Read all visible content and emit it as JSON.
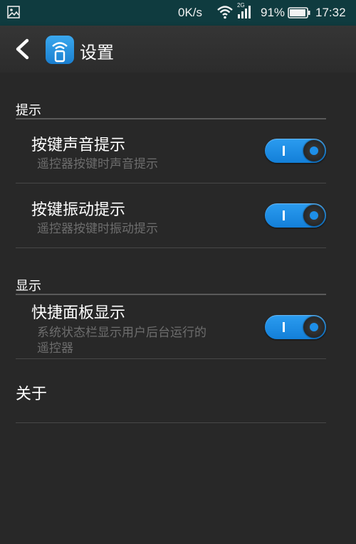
{
  "status_bar": {
    "network_speed": "0K/s",
    "signal_type": "2G",
    "battery_percent": "91%",
    "time": "17:32",
    "icons": [
      "image-notification-icon",
      "wifi-icon",
      "signal-icon",
      "battery-icon"
    ]
  },
  "app_bar": {
    "title": "设置",
    "icons": [
      "back-arrow-icon",
      "app-logo-icon"
    ]
  },
  "sections": [
    {
      "header": "提示",
      "items": [
        {
          "title": "按键声音提示",
          "subtitle": "遥控器按键时声音提示",
          "enabled": true
        },
        {
          "title": "按键振动提示",
          "subtitle": "遥控器按键时振动提示",
          "enabled": true
        }
      ]
    },
    {
      "header": "显示",
      "items": [
        {
          "title": "快捷面板显示",
          "subtitle_line1": "系统状态栏显示用户后台运行的",
          "subtitle_line2": "遥控器",
          "enabled": true
        }
      ]
    }
  ],
  "about": {
    "title": "关于"
  },
  "colors": {
    "status_bar_bg": "#0f3b3f",
    "background": "#282828",
    "accent": "#1e8fe8"
  }
}
